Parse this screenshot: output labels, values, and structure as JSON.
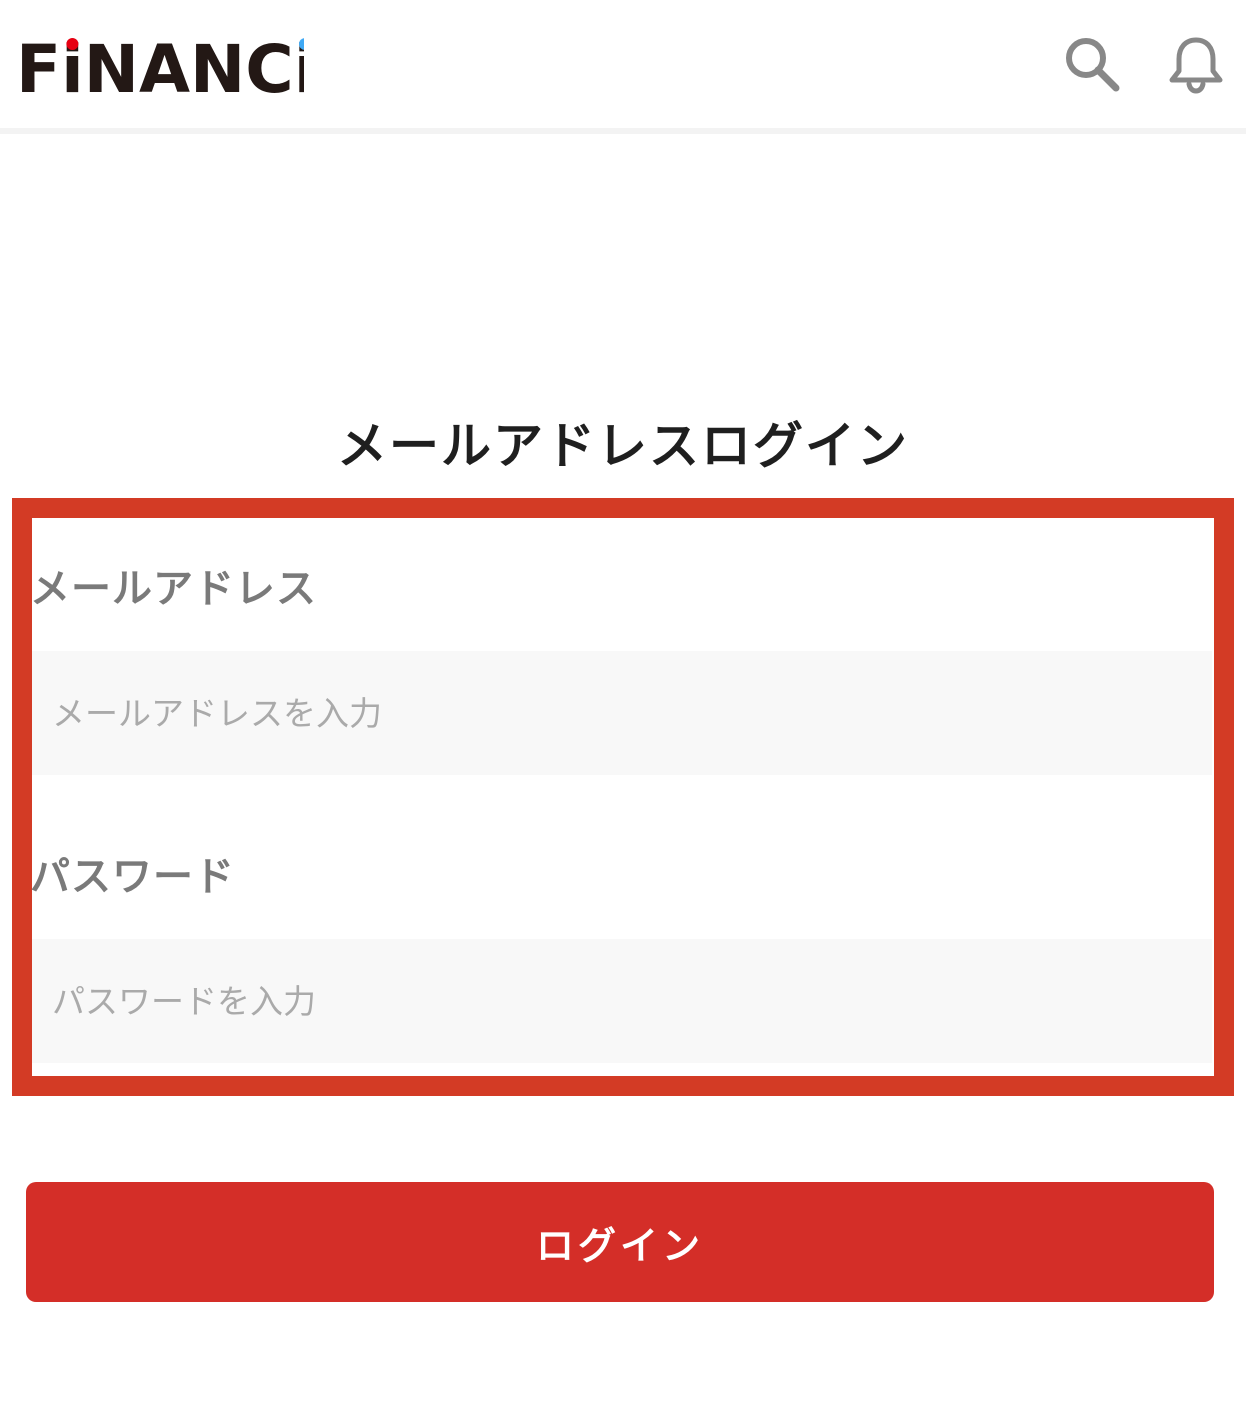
{
  "header": {
    "logo_text": "FiNANCiE",
    "logo_colors": {
      "text": "#231815",
      "dot_red": "#e60012",
      "dot_blue": "#3fa9f5"
    },
    "icons": [
      "search-icon",
      "bell-icon"
    ]
  },
  "main": {
    "title": "メールアドレスログイン",
    "email": {
      "label": "メールアドレス",
      "placeholder": "メールアドレスを入力",
      "value": ""
    },
    "password": {
      "label": "パスワード",
      "placeholder": "パスワードを入力",
      "value": ""
    },
    "login_button_label": "ログイン"
  },
  "colors": {
    "accent": "#d42e28",
    "highlight_frame": "#d33b25",
    "input_background": "#f8f8f8",
    "label": "#7a7a7a",
    "placeholder": "#aaaaaa"
  }
}
